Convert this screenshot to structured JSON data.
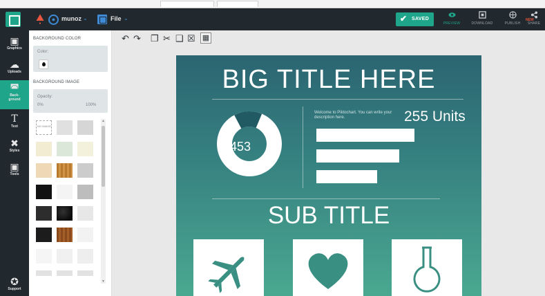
{
  "topbar": {
    "username": "munoz",
    "file_label": "File",
    "saved_label": "SAVED",
    "tools": [
      {
        "label": "PREVIEW"
      },
      {
        "label": "DOWNLOAD"
      },
      {
        "label": "PUBLISH"
      },
      {
        "label": "SHARE"
      }
    ],
    "new_badge": "NEW"
  },
  "rail": {
    "items": [
      {
        "label": "Graphics"
      },
      {
        "label": "Uploads"
      },
      {
        "label": "Back-\nground"
      },
      {
        "label": "Text"
      },
      {
        "label": "Styles"
      },
      {
        "label": "Tools"
      },
      {
        "label": "Support"
      }
    ]
  },
  "panel": {
    "bg_color_title": "BACKGROUND COLOR",
    "color_label": "Color:",
    "bg_image_title": "BACKGROUND IMAGE",
    "opacity_label": "Opacity:",
    "opacity_min": "0%",
    "opacity_max": "100%",
    "no_image_label": "NO IMAGE"
  },
  "canvas": {
    "big_title": "BIG TITLE HERE",
    "donut_value": "453",
    "description": "Welcome to Piktochart. You can write your description here.",
    "units": "255 Units",
    "sub_title": "SUB TITLE",
    "donut_fill": 0.86,
    "colors": {
      "bg_top": "#2b6571",
      "bg_bottom": "#4aa890",
      "icon": "#3a8f83"
    }
  },
  "colors": {
    "accent": "#1fa58a",
    "topbar": "#21282e",
    "pro": "#e8563f",
    "link": "#3d8bd6"
  }
}
